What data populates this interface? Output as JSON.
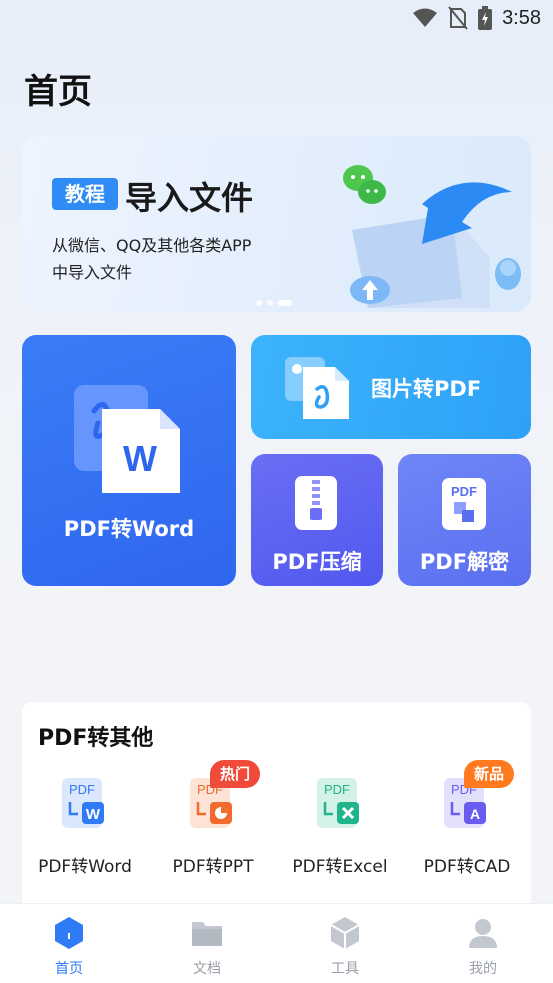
{
  "status_bar": {
    "time": "3:58"
  },
  "page": {
    "title": "首页"
  },
  "banner": {
    "tag": "教程",
    "title": "导入文件",
    "desc_line1": "从微信、QQ及其他各类APP",
    "desc_line2": "中导入文件",
    "dots": 3,
    "active_dot": 2
  },
  "features": {
    "pdf_to_word": "PDF转Word",
    "image_to_pdf": "图片转PDF",
    "pdf_compress": "PDF压缩",
    "pdf_decrypt": "PDF解密"
  },
  "tools": {
    "title": "PDF转其他",
    "items": [
      {
        "label": "PDF转Word",
        "icon": "pdf-to-word-icon",
        "accent": "#2f7bf5"
      },
      {
        "label": "PDF转PPT",
        "icon": "pdf-to-ppt-icon",
        "accent": "#f26a2e",
        "badge": "热门"
      },
      {
        "label": "PDF转Excel",
        "icon": "pdf-to-excel-icon",
        "accent": "#1fb48a"
      },
      {
        "label": "PDF转CAD",
        "icon": "pdf-to-cad-icon",
        "accent": "#6a5cf0",
        "badge": "新品"
      }
    ]
  },
  "nav": {
    "items": [
      {
        "label": "首页",
        "icon": "home-icon",
        "active": true
      },
      {
        "label": "文档",
        "icon": "folder-icon",
        "active": false
      },
      {
        "label": "工具",
        "icon": "tools-cube-icon",
        "active": false
      },
      {
        "label": "我的",
        "icon": "profile-icon",
        "active": false
      }
    ]
  },
  "colors": {
    "accent": "#2f7bf5",
    "hot_badge": "#f04a3a",
    "new_badge": "#ff7a1f"
  }
}
